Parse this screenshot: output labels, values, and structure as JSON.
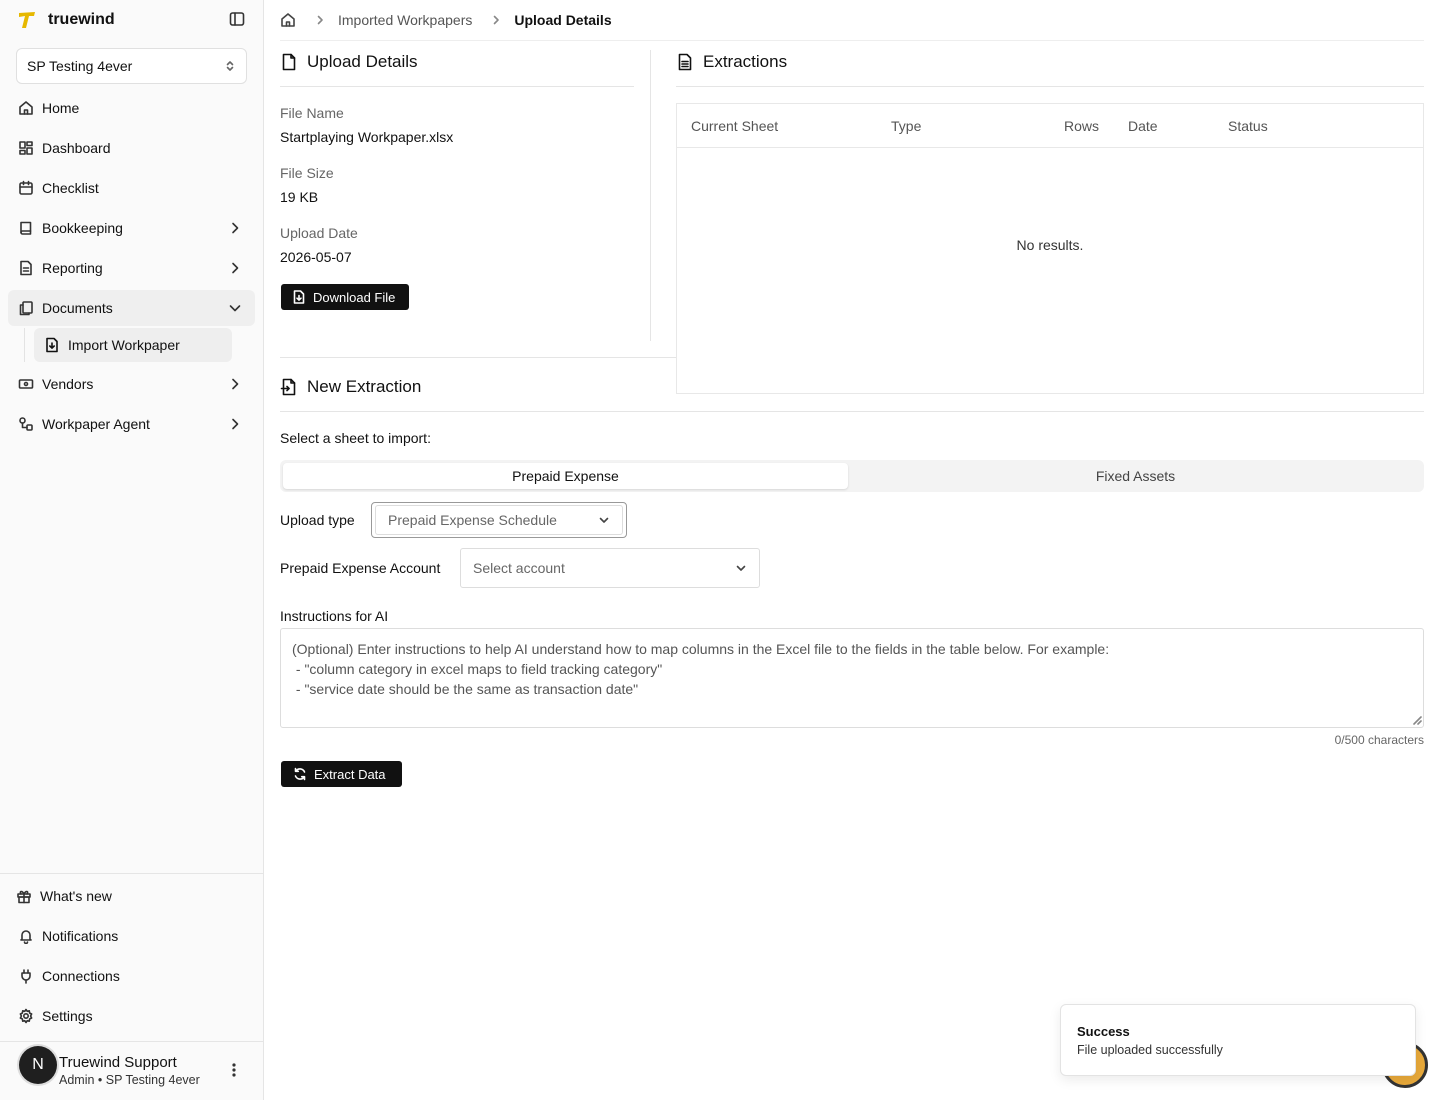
{
  "brand": {
    "name": "truewind",
    "accent": "#e6b800"
  },
  "org": {
    "selected": "SP Testing 4ever"
  },
  "nav": {
    "items": [
      {
        "label": "Home",
        "icon": "home-icon"
      },
      {
        "label": "Dashboard",
        "icon": "dashboard-icon"
      },
      {
        "label": "Checklist",
        "icon": "calendar-icon"
      },
      {
        "label": "Bookkeeping",
        "icon": "book-icon"
      },
      {
        "label": "Reporting",
        "icon": "report-icon"
      },
      {
        "label": "Documents",
        "icon": "documents-icon"
      },
      {
        "label": "Vendors",
        "icon": "vendors-icon"
      },
      {
        "label": "Workpaper Agent",
        "icon": "agent-icon"
      }
    ],
    "documents_sub": {
      "label": "Import Workpaper"
    }
  },
  "bottom_nav": {
    "whats_new": "What's new",
    "notifications": "Notifications",
    "connections": "Connections",
    "settings": "Settings"
  },
  "user": {
    "initial": "N",
    "name": "Truewind Support",
    "role": "Admin • SP Testing 4ever"
  },
  "breadcrumb": {
    "parent": "Imported Workpapers",
    "current": "Upload Details"
  },
  "upload_details": {
    "title": "Upload Details",
    "file_name_label": "File Name",
    "file_name": "Startplaying Workpaper.xlsx",
    "file_size_label": "File Size",
    "file_size": "19 KB",
    "upload_date_label": "Upload Date",
    "upload_date": "2026-05-07",
    "download_label": "Download File"
  },
  "extractions": {
    "title": "Extractions",
    "columns": [
      "Current Sheet",
      "Type",
      "Rows",
      "Date",
      "Status"
    ],
    "empty_text": "No results."
  },
  "new_extraction": {
    "title": "New Extraction",
    "prompt": "Select a sheet to import:",
    "tabs": [
      "Prepaid Expense",
      "Fixed Assets"
    ],
    "upload_type_label": "Upload type",
    "upload_type_value": "Prepaid Expense Schedule",
    "account_label": "Prepaid Expense Account",
    "account_placeholder": "Select account",
    "instructions_label": "Instructions for AI",
    "instructions_placeholder": "(Optional) Enter instructions to help AI understand how to map columns in the Excel file to the fields in the table below. For example:\n - \"column category in excel maps to field tracking category\"\n - \"service date should be the same as transaction date\"",
    "char_count": "0/500 characters",
    "extract_label": "Extract Data"
  },
  "toast": {
    "title": "Success",
    "message": "File uploaded successfully"
  }
}
